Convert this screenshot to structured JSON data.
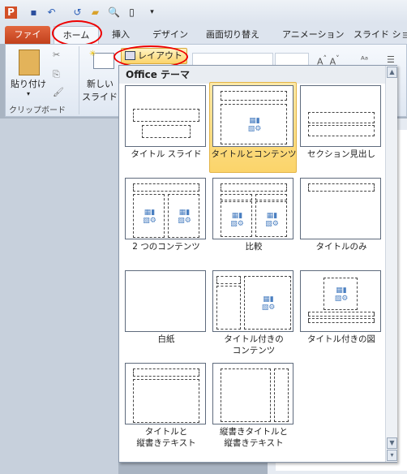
{
  "qat": {
    "icons": [
      "powerpoint-icon",
      "save-icon",
      "undo-icon",
      "redo-icon",
      "open-icon",
      "print-preview-icon",
      "new-icon",
      "customize-icon"
    ]
  },
  "tabs": [
    "ファイル",
    "ホーム",
    "挿入",
    "デザイン",
    "画面切り替え",
    "アニメーション",
    "スライド ショー"
  ],
  "ribbon": {
    "paste": "貼り付け",
    "new_slide_1": "新しい",
    "new_slide_2": "スライド",
    "clipboard_group": "クリップボード",
    "layout_button": "レイアウト"
  },
  "menu": {
    "header": "Office テーマ",
    "items": [
      {
        "label": "タイトル スライド",
        "selected": false
      },
      {
        "label": "タイトルとコンテンツ",
        "selected": true
      },
      {
        "label": "セクション見出し",
        "selected": false
      },
      {
        "label": "2 つのコンテンツ",
        "selected": false
      },
      {
        "label": "比較",
        "selected": false
      },
      {
        "label": "タイトルのみ",
        "selected": false
      },
      {
        "label": "白紙",
        "selected": false
      },
      {
        "label": "タイトル付きの\nコンテンツ",
        "selected": false
      },
      {
        "label": "タイトル付きの図",
        "selected": false
      },
      {
        "label": "タイトルと\n縦書きテキスト",
        "selected": false
      },
      {
        "label": "縦書きタイトルと\n縦書きテキスト",
        "selected": false
      }
    ]
  },
  "colors": {
    "file_tab": "#d24f27",
    "highlight": "#fbd46a",
    "annotation": "#e00000"
  }
}
